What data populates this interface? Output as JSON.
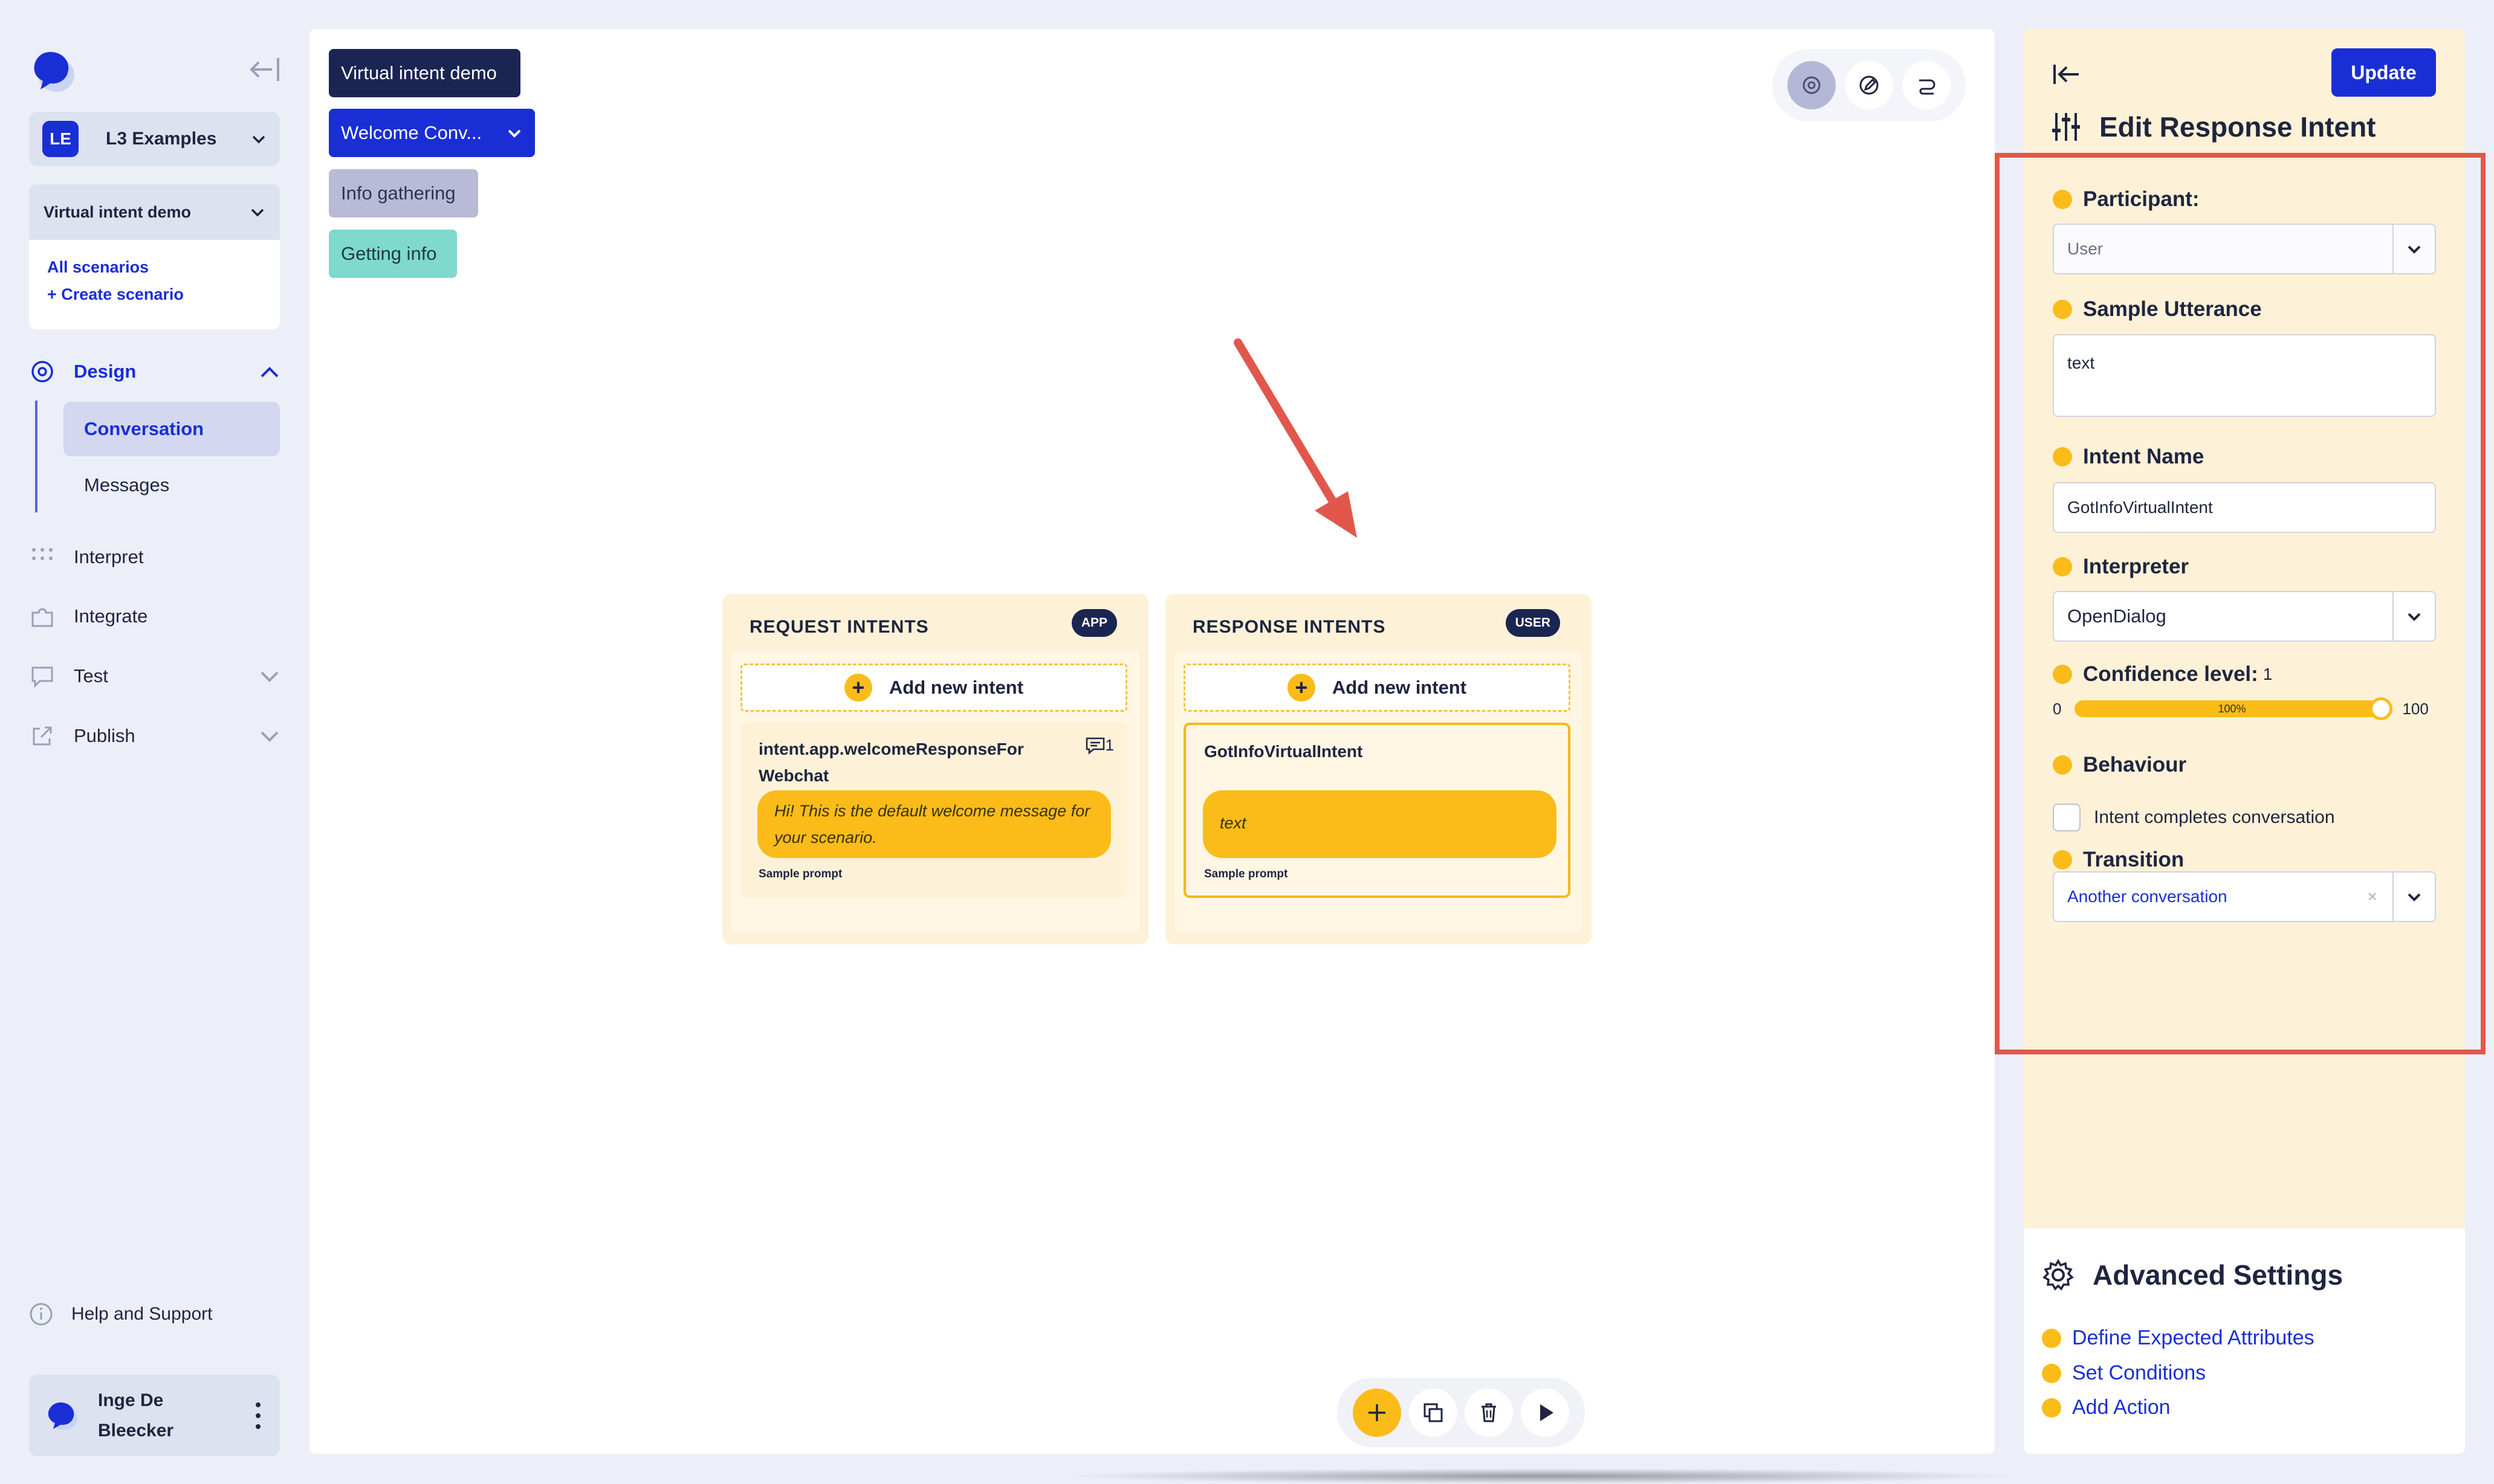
{
  "sidebar": {
    "workspace": {
      "badge": "LE",
      "name": "L3 Examples"
    },
    "scenario": {
      "name": "Virtual intent demo",
      "all_link": "All scenarios",
      "create_link": "+ Create scenario"
    },
    "nav": {
      "design": "Design",
      "conversation": "Conversation",
      "messages": "Messages",
      "interpret": "Interpret",
      "integrate": "Integrate",
      "test": "Test",
      "publish": "Publish"
    },
    "help": "Help and Support",
    "user": {
      "name_line1": "Inge De",
      "name_line2": "Bleecker"
    }
  },
  "canvas": {
    "chips": {
      "scenario": "Virtual intent demo",
      "conversation": "Welcome Conv...",
      "scene": "Info gathering",
      "turn": "Getting info"
    },
    "request": {
      "title": "REQUEST INTENTS",
      "badge": "APP",
      "add_label": "Add new intent",
      "intent_name": "intent.app.welcomeResponseFor Webchat",
      "count": "1",
      "message": "Hi! This is the default welcome message for your scenario.",
      "sample": "Sample prompt"
    },
    "response": {
      "title": "RESPONSE INTENTS",
      "badge": "USER",
      "add_label": "Add new intent",
      "intent_name": "GotInfoVirtualIntent",
      "message": "text",
      "sample": "Sample prompt"
    }
  },
  "panel": {
    "update_label": "Update",
    "title": "Edit Response Intent",
    "participant": {
      "label": "Participant:",
      "value": "User"
    },
    "utterance": {
      "label": "Sample Utterance",
      "value": "text"
    },
    "intent_name": {
      "label": "Intent Name",
      "value": "GotInfoVirtualIntent"
    },
    "interpreter": {
      "label": "Interpreter",
      "value": "OpenDialog"
    },
    "confidence": {
      "label": "Confidence level:",
      "value": "1",
      "min": "0",
      "max": "100",
      "pct": "100%"
    },
    "behaviour": {
      "label": "Behaviour",
      "checkbox_label": "Intent completes conversation",
      "checked": false
    },
    "transition": {
      "label": "Transition",
      "value": "Another conversation",
      "clear": "×"
    }
  },
  "advanced": {
    "title": "Advanced Settings",
    "items": [
      "Define Expected Attributes",
      "Set Conditions",
      "Add Action"
    ]
  },
  "colors": {
    "accent": "#1a2ed6",
    "yellow": "#fbbc1a",
    "navy": "#1b2552",
    "highlight": "#e2574c"
  }
}
